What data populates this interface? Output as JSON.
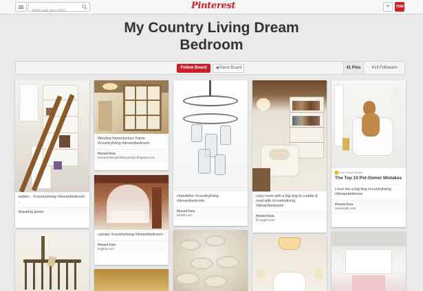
{
  "header": {
    "search_placeholder": "What are you into?",
    "logo": "Pinterest",
    "add_label": "+",
    "profile_label": "TOM"
  },
  "board": {
    "title_line1": "My Country Living Dream",
    "title_line2": "Bedroom",
    "follow_label": "Follow Board",
    "send_label": "Send Board",
    "pins_count": "41 Pins",
    "followers_count": "414 Followers"
  },
  "pins": [
    {
      "desc": "ladder... #countryliving #dreambedroom",
      "meta": "1",
      "via_label": "Pinned by pinner",
      "via_source": ""
    },
    {
      "desc": "Window frame/picture frame #countryliving #dreambedroom",
      "via_label": "Pinned from",
      "via_source": "homeandsimplelifebydesign.blogspot.com"
    },
    {
      "desc": "chandelier #countryliving #dreambedroom",
      "via_label": "Pinned from",
      "via_source": "tumblr.com"
    },
    {
      "desc": "cozy room with a big dog to cuddle & read with #countryliving #dreambedroom",
      "via_label": "Pinned from",
      "via_source": "ficl.pgpm.com"
    },
    {
      "rich_source": "from Real Simple",
      "rich_title": "The Top 10 Pet-Owner Mistakes",
      "desc": "I love me a big dog #countryliving #dreambedroom",
      "via_label": "Pinned from",
      "via_source": "realsimple.com"
    },
    {
      "desc": "canopy #countryliving #dreambedroom",
      "via_label": "Pinned from",
      "via_source": "tinglink.com"
    }
  ],
  "colors": {
    "brand_red": "#cb2027",
    "background": "#e9e9e9"
  }
}
